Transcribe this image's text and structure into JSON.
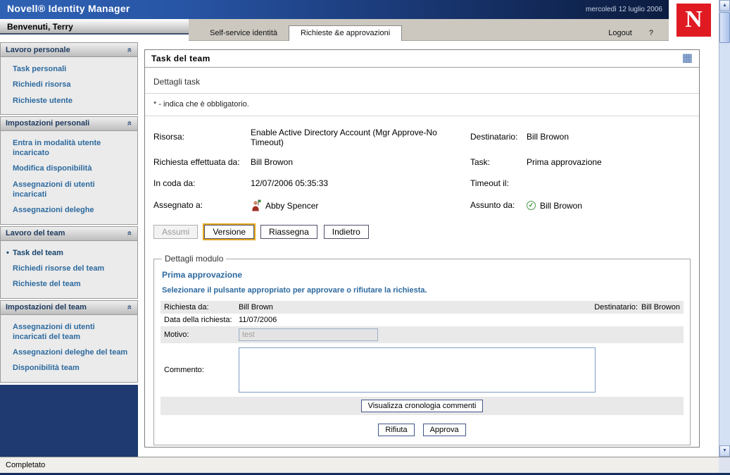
{
  "colors": {
    "novell_red": "#e01a22",
    "header_blue": "#1b3a78",
    "link_blue": "#2d6a9f",
    "sidebar_fill_blue": "#1f3a70",
    "focus_ring_orange": "#e3a81d"
  },
  "icons": {
    "collapse": "«",
    "grid": "▦",
    "scroll_up": "▲",
    "scroll_down": "▼",
    "check": "✓",
    "active_bullet": "•"
  },
  "header": {
    "app_title": "Novell® Identity Manager",
    "date": "mercoledì 12 luglio 2006",
    "welcome": "Benvenuti, Terry",
    "novell_logo_letter": "N",
    "tabs": [
      {
        "label": "Self-service identità",
        "active": false
      },
      {
        "label": "Richieste &e approvazioni",
        "active": true
      }
    ],
    "logout_label": "Logout",
    "help_label": "?"
  },
  "sidebar": {
    "sections": [
      {
        "title": "Lavoro personale",
        "items": [
          "Task personali",
          "Richiedi risorsa",
          "Richieste utente"
        ]
      },
      {
        "title": "Impostazioni personali",
        "items": [
          "Entra in modalità utente incaricato",
          "Modifica disponibilità",
          "Assegnazioni di utenti incaricati",
          "Assegnazioni deleghe"
        ]
      },
      {
        "title": "Lavoro del team",
        "items": [
          "Task del team",
          "Richiedi risorse del team",
          "Richieste del team"
        ],
        "active_item": "Task del team"
      },
      {
        "title": "Impostazioni del team",
        "items": [
          "Assegnazioni di utenti incaricati del team",
          "Assegnazioni deleghe del team",
          "Disponibilità team"
        ]
      }
    ]
  },
  "main": {
    "panel_title": "Task del team",
    "section_heading": "Dettagli task",
    "required_note": "* - indica che è obbligatorio.",
    "details": {
      "risorsa_label": "Risorsa:",
      "risorsa_value": "Enable Active Directory Account (Mgr Approve-No Timeout)",
      "destinatario_label": "Destinatario:",
      "destinatario_value": "Bill Browon",
      "richiesta_da_label": "Richiesta effettuata da:",
      "richiesta_da_value": "Bill Browon",
      "task_label": "Task:",
      "task_value": "Prima approvazione",
      "in_coda_label": "In coda da:",
      "in_coda_value": "12/07/2006 05:35:33",
      "timeout_label": "Timeout il:",
      "timeout_value": "",
      "assegnato_label": "Assegnato a:",
      "assegnato_value": "Abby Spencer",
      "assunto_label": "Assunto da:",
      "assunto_value": "Bill Browon"
    },
    "actions": {
      "assumi": "Assumi",
      "versione": "Versione",
      "riassegna": "Riassegna",
      "indietro": "Indietro"
    },
    "form": {
      "legend": "Dettagli modulo",
      "title": "Prima approvazione",
      "instruction": "Selezionare il pulsante appropriato per approvare o rifiutare la richiesta.",
      "richiesta_da_label": "Richiesta da:",
      "richiesta_da_value": "Bill Brown",
      "destinatario_label": "Destinatario:",
      "destinatario_value": "Bill Browon",
      "data_label": "Data della richiesta:",
      "data_value": "11/07/2006",
      "motivo_label": "Motivo:",
      "motivo_value": "test",
      "commento_label": "Commento:",
      "commento_value": "",
      "cronologia_button": "Visualizza cronologia commenti",
      "rifiuta_button": "Rifiuta",
      "approva_button": "Approva"
    }
  },
  "footer": {
    "status": "Completato"
  }
}
